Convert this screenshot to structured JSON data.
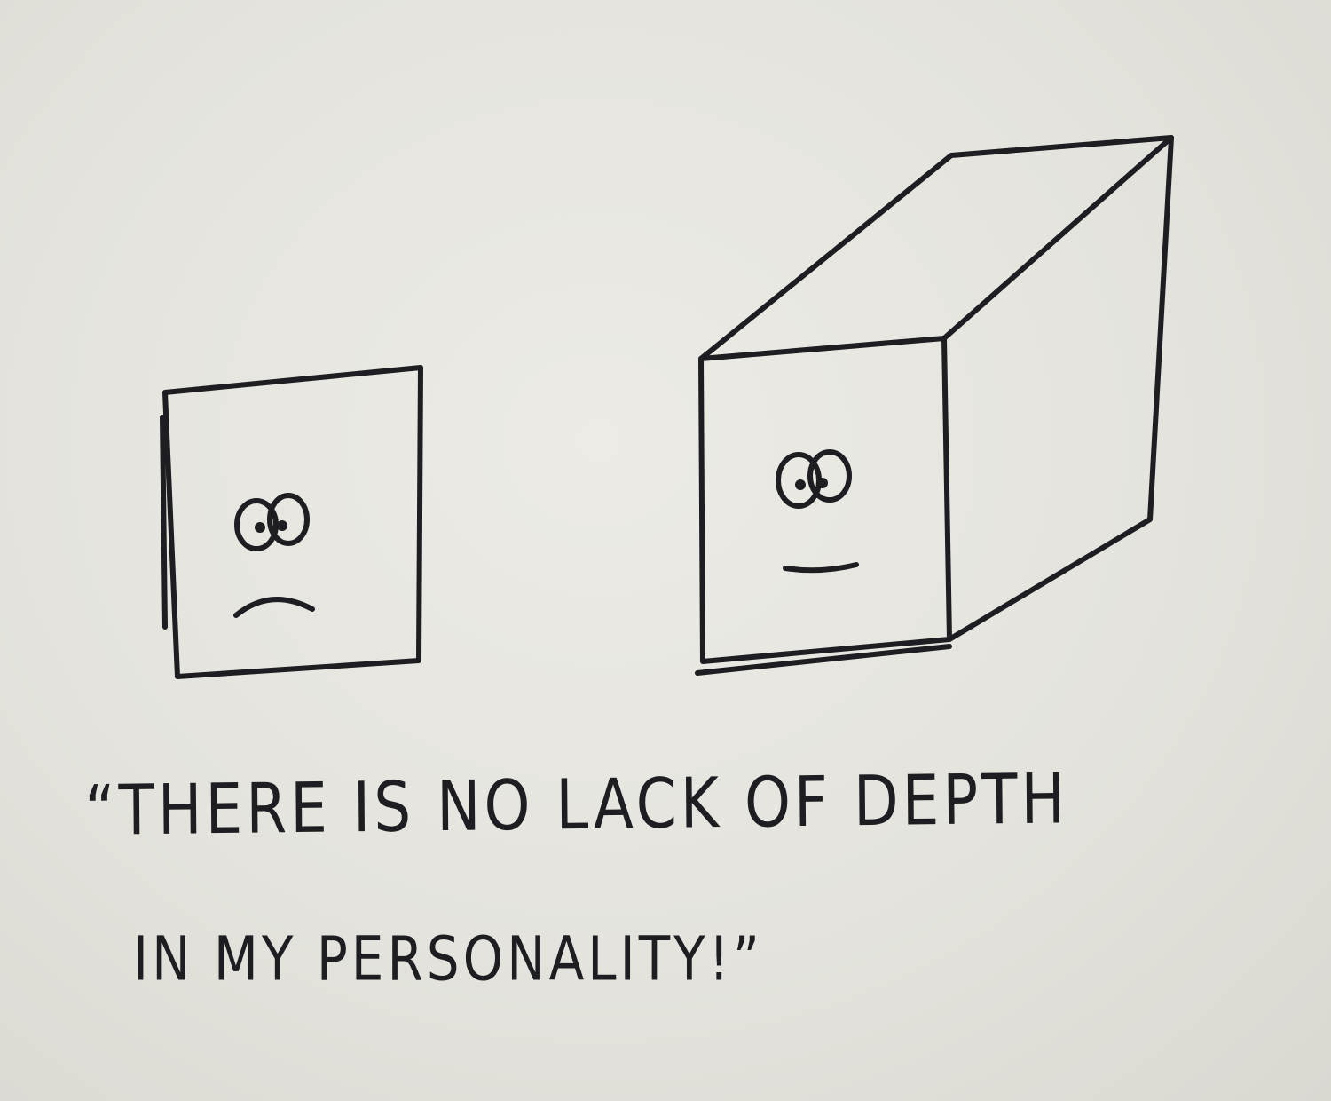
{
  "caption": {
    "line1": "“THERE IS NO LACK OF DEPTH",
    "line2": "IN MY PERSONALITY!”"
  },
  "figures": {
    "flat_square": {
      "expression": "sad"
    },
    "cube": {
      "expression": "neutral"
    }
  },
  "colors": {
    "ink": "#1d1d22",
    "paper": "#e3e2dc"
  }
}
